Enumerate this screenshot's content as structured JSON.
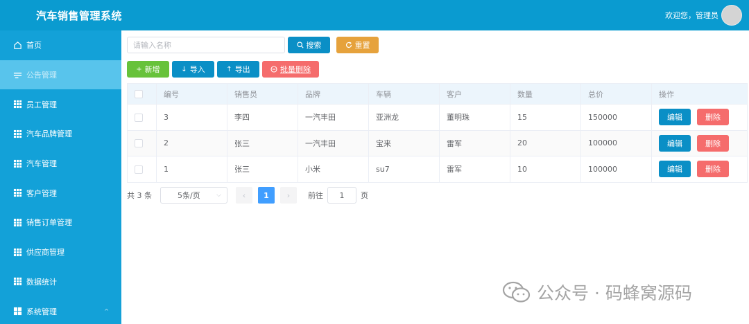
{
  "header": {
    "title": "汽车销售管理系统",
    "welcome": "欢迎您，管理员"
  },
  "sidebar": {
    "items": [
      {
        "label": "首页",
        "icon": "home-icon"
      },
      {
        "label": "公告管理",
        "icon": "notice-icon",
        "active": true
      },
      {
        "label": "员工管理",
        "icon": "grid-icon"
      },
      {
        "label": "汽车品牌管理",
        "icon": "grid-icon"
      },
      {
        "label": "汽车管理",
        "icon": "grid-icon"
      },
      {
        "label": "客户管理",
        "icon": "grid-icon"
      },
      {
        "label": "销售订单管理",
        "icon": "grid-icon"
      },
      {
        "label": "供应商管理",
        "icon": "grid-icon"
      },
      {
        "label": "数据统计",
        "icon": "grid-icon"
      },
      {
        "label": "系统管理",
        "icon": "grid-icon",
        "caret": "^"
      }
    ]
  },
  "search": {
    "placeholder": "请输入名称",
    "search_label": "搜索",
    "reset_label": "重置"
  },
  "actions": {
    "add_label": "新增",
    "import_label": "导入",
    "export_label": "导出",
    "batch_delete_label": "批量删除"
  },
  "table": {
    "headers": [
      "编号",
      "销售员",
      "品牌",
      "车辆",
      "客户",
      "数量",
      "总价",
      "操作"
    ],
    "rows": [
      {
        "id": "3",
        "salesperson": "李四",
        "brand": "一汽丰田",
        "vehicle": "亚洲龙",
        "customer": "董明珠",
        "quantity": "15",
        "total": "150000"
      },
      {
        "id": "2",
        "salesperson": "张三",
        "brand": "一汽丰田",
        "vehicle": "宝来",
        "customer": "雷军",
        "quantity": "20",
        "total": "100000"
      },
      {
        "id": "1",
        "salesperson": "张三",
        "brand": "小米",
        "vehicle": "su7",
        "customer": "雷军",
        "quantity": "10",
        "total": "100000"
      }
    ],
    "edit_label": "编辑",
    "delete_label": "删除"
  },
  "pagination": {
    "total_text": "共 3 条",
    "page_size": "5条/页",
    "current_page": "1",
    "goto_label": "前往",
    "goto_value": "1",
    "page_suffix": "页"
  },
  "watermark": {
    "text": "公众号 · 码蜂窝源码"
  },
  "colors": {
    "header": "#0a9bd0",
    "sidebar": "#13a1d8",
    "sidebar_active": "#58c4ec",
    "primary": "#0a8fc6",
    "success": "#67c23a",
    "warning": "#e6a23c",
    "danger": "#f56c6c",
    "pager_active": "#409eff"
  }
}
